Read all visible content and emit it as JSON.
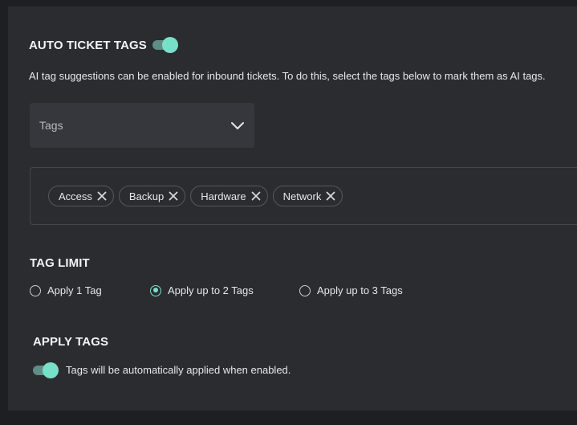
{
  "auto_tags": {
    "title": "AUTO TICKET TAGS",
    "enabled": true,
    "description": "AI tag suggestions can be enabled for inbound tickets. To do this, select the tags below to mark them as AI tags."
  },
  "tags_select": {
    "placeholder": "Tags"
  },
  "selected_tags": [
    {
      "label": "Access"
    },
    {
      "label": "Backup"
    },
    {
      "label": "Hardware"
    },
    {
      "label": "Network"
    }
  ],
  "tag_limit": {
    "title": "TAG LIMIT",
    "options": [
      {
        "label": "Apply 1 Tag",
        "checked": false
      },
      {
        "label": "Apply up to 2 Tags",
        "checked": true
      },
      {
        "label": "Apply up to 3 Tags",
        "checked": false
      }
    ]
  },
  "apply_tags": {
    "title": "APPLY TAGS",
    "enabled": true,
    "description": "Tags will be automatically applied when enabled."
  },
  "colors": {
    "accent": "#78e0c8",
    "toggle_track": "#5e8e86",
    "panel_bg": "#2b2c30",
    "page_bg": "#1e1f22"
  },
  "icons": {
    "dropdown": "chevron-down-icon",
    "chip_remove": "close-icon"
  }
}
